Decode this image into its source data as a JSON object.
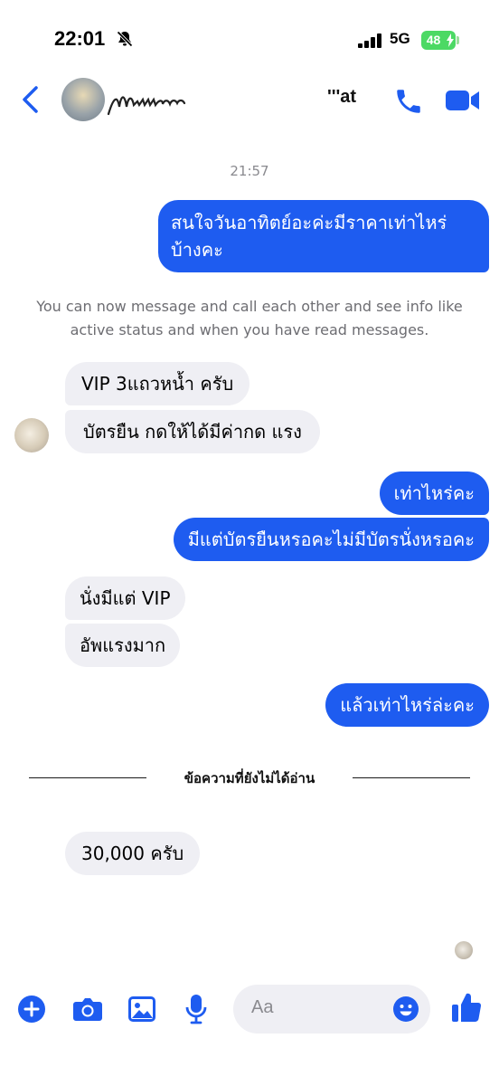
{
  "status_bar": {
    "time": "22:01",
    "network": "5G",
    "battery": "48"
  },
  "header": {
    "contact_name": "'''at"
  },
  "chat": {
    "timestamp": "21:57",
    "outgoing_1": [
      "สนใจวันอาทิตย์อะค่ะมีราคาเท่าไหร่",
      "บ้างคะ"
    ],
    "notice": [
      "You can now message and call each other and see info like",
      "active status and when you have read messages."
    ],
    "incoming_1": "VIP 3แถวหน้ำ ครับ",
    "incoming_2": "บัตรยืน กดให้ได้มีค่ากด แรง",
    "outgoing_2": "เท่าไหร่คะ",
    "outgoing_3": "มีแต่บัตรยืนหรอคะไม่มีบัตรนั่งหรอคะ",
    "incoming_3": "นั่งมีแต่ VIP",
    "incoming_4": "อัพแรงมาก",
    "outgoing_4": "แล้วเท่าไหร่ล่ะคะ",
    "unread_divider": "ข้อความที่ยังไม่ได้อ่าน",
    "incoming_5": "30,000 ครับ"
  },
  "composer": {
    "placeholder": "Aa"
  },
  "colors": {
    "accent": "#1e5cf0",
    "incoming_bubble": "#efeff4",
    "battery": "#4cd964"
  },
  "icons": [
    "bell-slash-icon",
    "signal-icon",
    "battery-icon",
    "back-chevron-icon",
    "phone-icon",
    "video-icon",
    "plus-icon",
    "camera-icon",
    "image-icon",
    "microphone-icon",
    "emoji-icon",
    "thumbs-up-icon"
  ]
}
